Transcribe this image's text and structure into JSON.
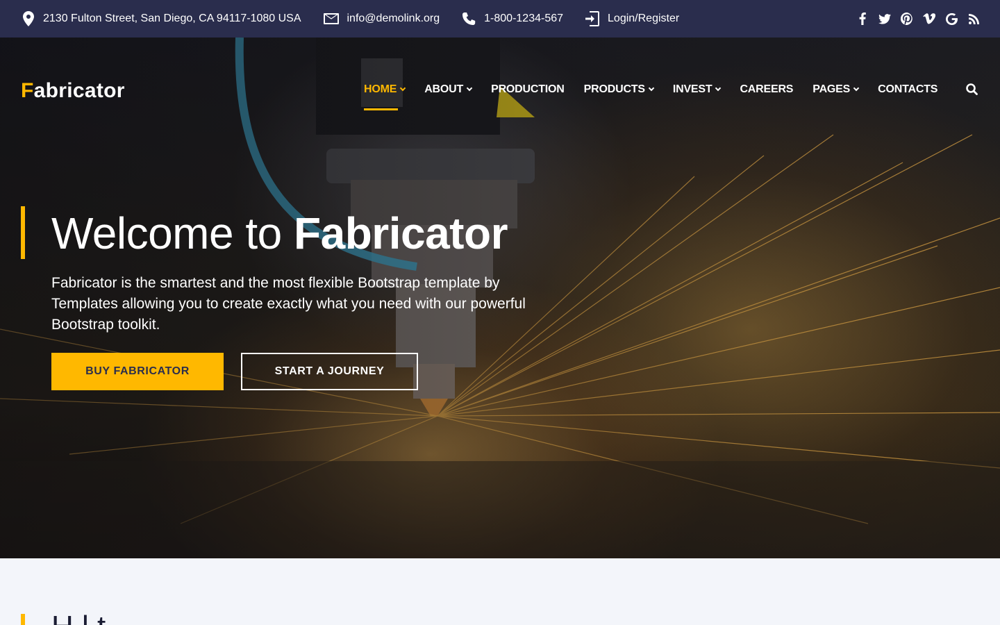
{
  "topbar": {
    "address": "2130 Fulton Street, San Diego, CA 94117-1080 USA",
    "email": "info@demolink.org",
    "phone": "1-800-1234-567",
    "login": "Login/Register",
    "social": [
      "facebook-icon",
      "twitter-icon",
      "pinterest-icon",
      "vimeo-icon",
      "google-icon",
      "rss-icon"
    ]
  },
  "header": {
    "logo_first": "F",
    "logo_rest": "abricator",
    "nav": [
      {
        "label": "HOME",
        "dropdown": true,
        "active": true
      },
      {
        "label": "ABOUT",
        "dropdown": true
      },
      {
        "label": "PRODUCTION",
        "dropdown": false
      },
      {
        "label": "PRODUCTS",
        "dropdown": true
      },
      {
        "label": "INVEST",
        "dropdown": true
      },
      {
        "label": "CAREERS",
        "dropdown": false
      },
      {
        "label": "PAGES",
        "dropdown": true
      },
      {
        "label": "CONTACTS",
        "dropdown": false
      }
    ]
  },
  "hero": {
    "title_plain": "Welcome to ",
    "title_bold": "Fabricator",
    "text": "Fabricator is the smartest and the most flexible Bootstrap template by Templates allowing you to create exactly what you need with our powerful Bootstrap toolkit.",
    "primary_button": "BUY FABRICATOR",
    "secondary_button": "START A JOURNEY"
  },
  "section": {
    "title_partial": "H     l     t"
  },
  "colors": {
    "accent": "#ffb800",
    "topbar_bg": "#2a2d4d",
    "section_bg": "#f3f5fa"
  }
}
